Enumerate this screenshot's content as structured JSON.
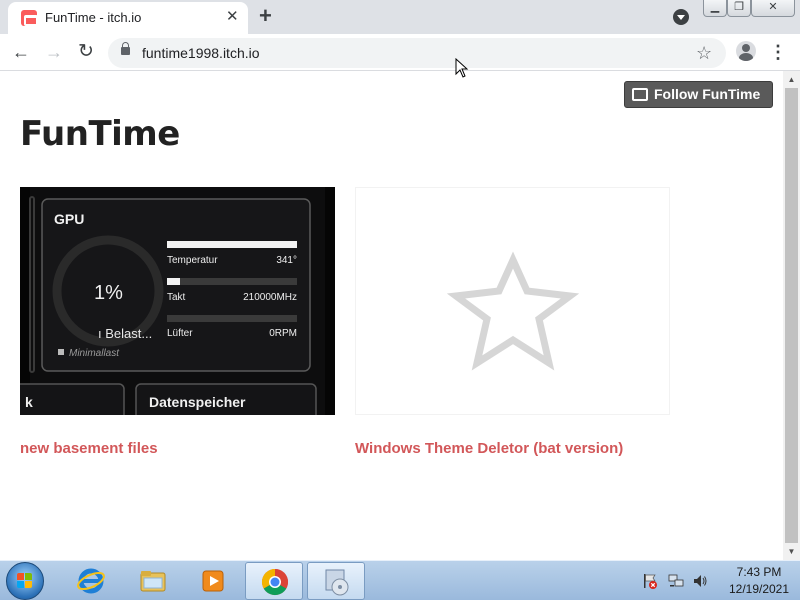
{
  "browser": {
    "tab_title": "FunTime - itch.io",
    "tab_close_glyph": "✕",
    "new_tab_glyph": "+",
    "url": "funtime1998.itch.io",
    "window_controls": {
      "minimize": "▁",
      "maximize": "❐",
      "close": "✕"
    },
    "nav": {
      "back": "←",
      "forward": "→",
      "reload": "↻"
    },
    "bookmark_glyph": "☆",
    "menu_glyph": "⋮"
  },
  "page": {
    "follow_button": "Follow FunTime",
    "title": "FunTime",
    "games": [
      {
        "title": "new basement files",
        "thumb": {
          "gpu_label": "GPU",
          "gauge_value": "1%",
          "gauge_sub": "ı Belast...",
          "minimal_load": "Minimallast",
          "rows": [
            {
              "label": "Temperatur",
              "value": "341°",
              "fill": 1.0
            },
            {
              "label": "Takt",
              "value": "210000MHz",
              "fill": 0.1
            },
            {
              "label": "Lüfter",
              "value": "0RPM",
              "fill": 0.0
            }
          ],
          "lower_left": "k",
          "lower_right": "Datenspeicher"
        }
      },
      {
        "title": "Windows Theme Deletor (bat version)",
        "thumb": {
          "placeholder_icon": "star-outline-icon"
        }
      }
    ]
  },
  "scrollbar": {
    "up": "▲",
    "down": "▼"
  },
  "taskbar": {
    "pinned": [
      "internet-explorer-icon",
      "folder-icon",
      "media-player-icon",
      "chrome-icon",
      "setup-disc-icon"
    ],
    "clock_time": "7:43 PM",
    "clock_date": "12/19/2021"
  },
  "colors": {
    "accent_link": "#d25759",
    "follow_bg": "#5a5a5a",
    "tabbar_bg": "#dee1e6"
  }
}
